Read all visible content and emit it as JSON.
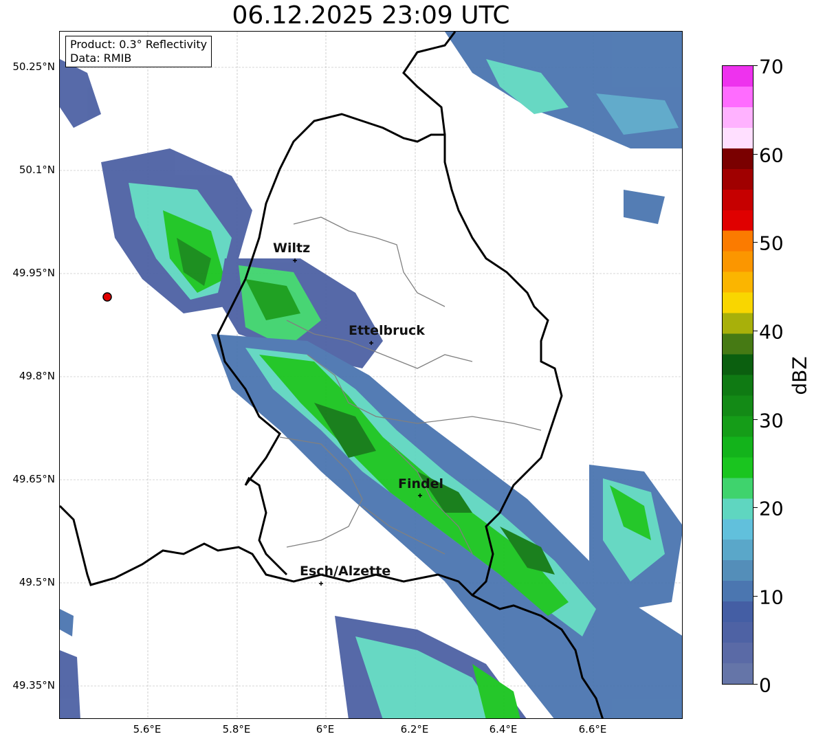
{
  "title": "06.12.2025 23:09 UTC",
  "info": {
    "line1": "Product: 0.3° Reflectivity",
    "line2": "Data: RMIB"
  },
  "axes": {
    "lat_ticks": [
      "50.25°N",
      "50.1°N",
      "49.95°N",
      "49.8°N",
      "49.65°N",
      "49.5°N",
      "49.35°N"
    ],
    "lon_ticks": [
      "5.6°E",
      "5.8°E",
      "6°E",
      "6.2°E",
      "6.4°E",
      "6.6°E"
    ]
  },
  "cities": [
    {
      "name": "Wiltz"
    },
    {
      "name": "Ettelbruck"
    },
    {
      "name": "Findel"
    },
    {
      "name": "Esch/Alzette"
    }
  ],
  "colorbar": {
    "unit": "dBZ",
    "tick_labels": [
      "70",
      "60",
      "50",
      "40",
      "30",
      "20",
      "10",
      "0"
    ],
    "colors": [
      "#6575a8",
      "#5a6aa6",
      "#4e62a4",
      "#445ea4",
      "#4b76b0",
      "#548eb9",
      "#5aa7c9",
      "#61c0dc",
      "#5fd6c0",
      "#3fd36d",
      "#1ac51f",
      "#13b31b",
      "#159d18",
      "#138a16",
      "#0f7a13",
      "#0b5f0f",
      "#467a14",
      "#a8b00a",
      "#f9d600",
      "#fbb500",
      "#fb9600",
      "#fb7b00",
      "#e00000",
      "#c60000",
      "#a00000",
      "#7a0000",
      "#ffdfff",
      "#ffb2ff",
      "#ff6cff",
      "#ee32ee"
    ]
  },
  "radar_marker": {
    "label": "radar site",
    "color": "#e00000"
  }
}
